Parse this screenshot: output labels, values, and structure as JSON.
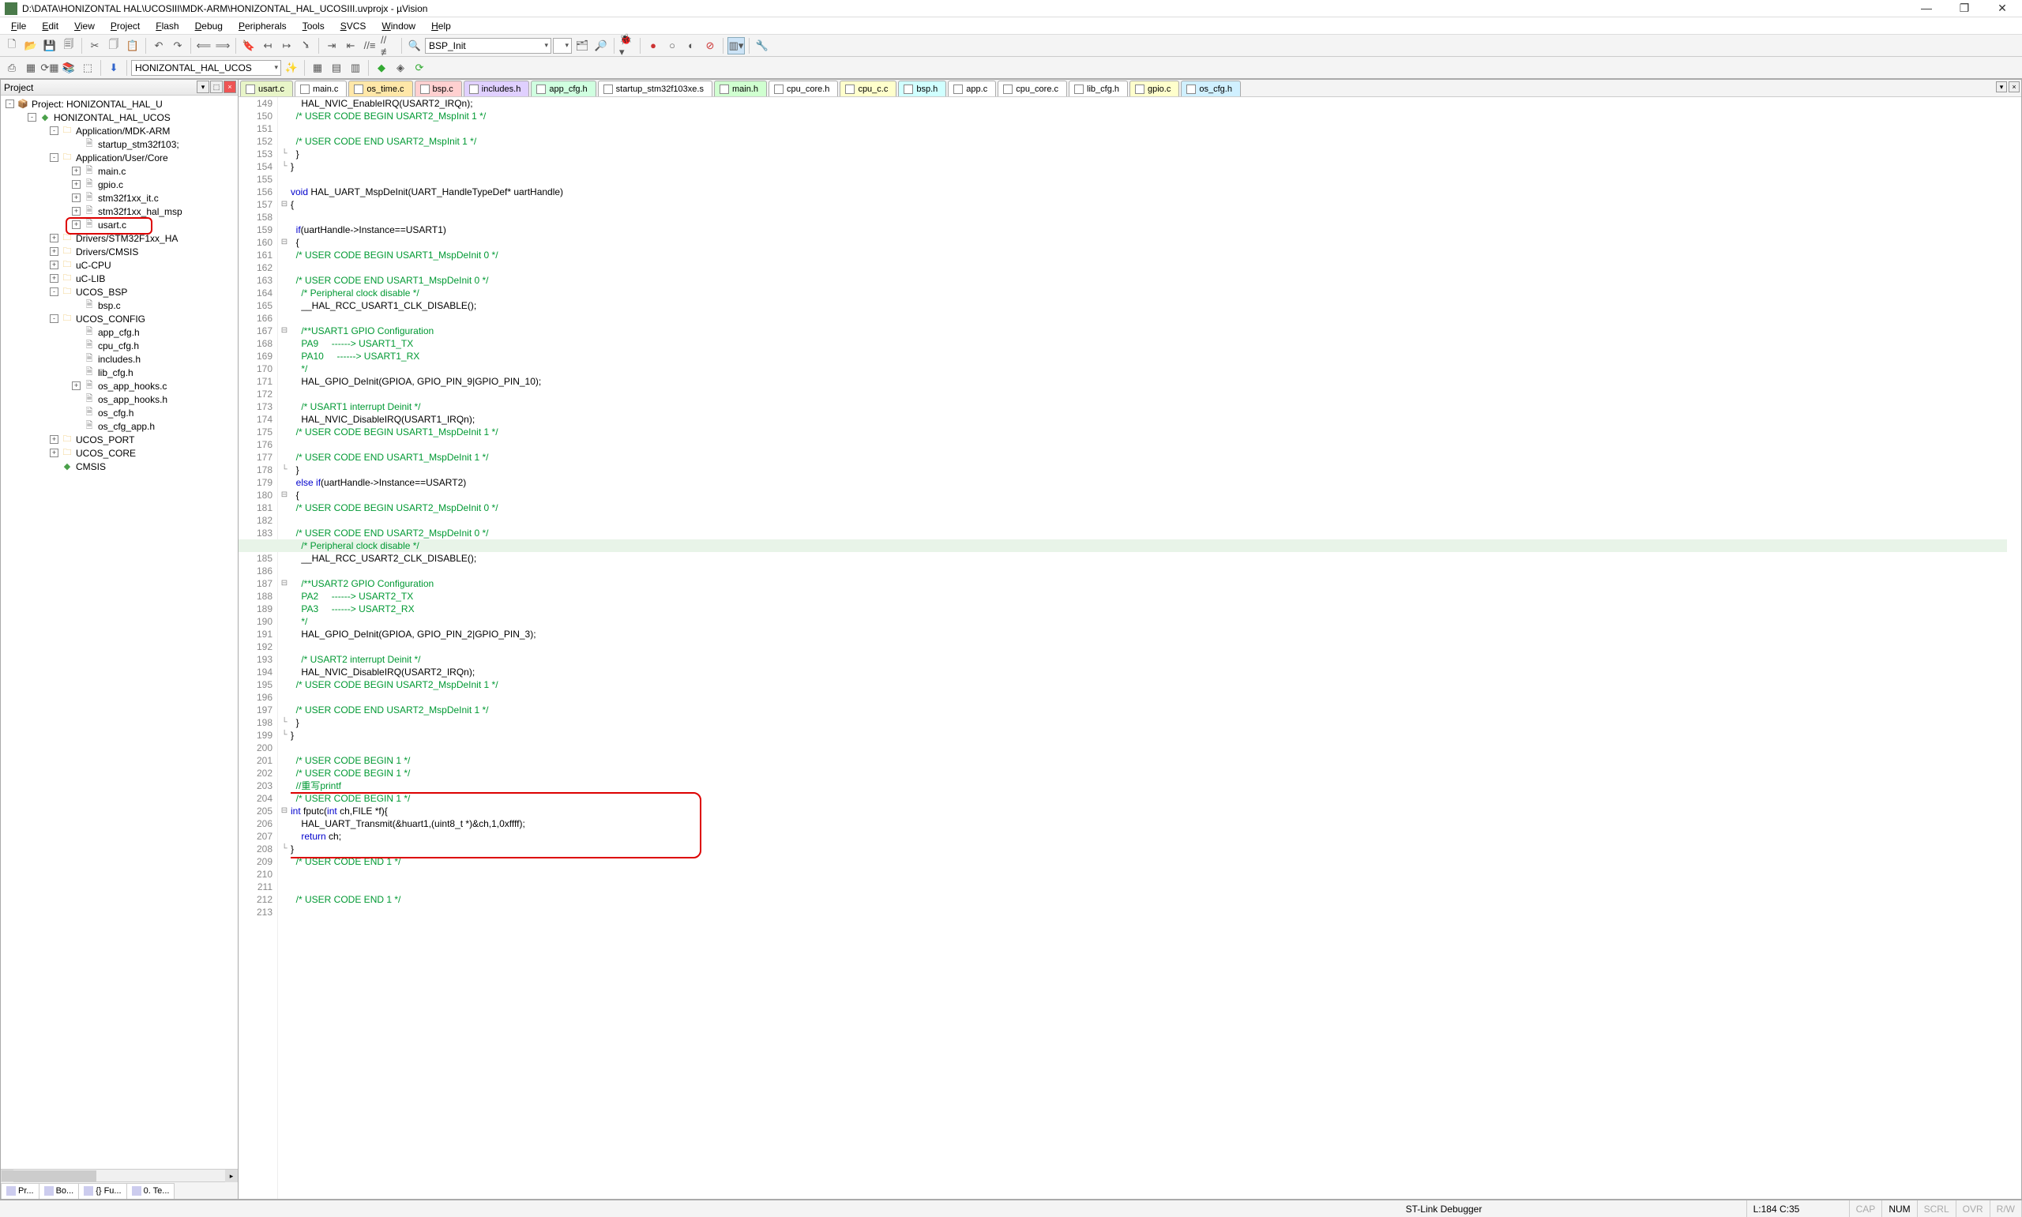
{
  "title_bar": {
    "title": "D:\\DATA\\HONIZONTAL HAL\\UCOSIII\\MDK-ARM\\HONIZONTAL_HAL_UCOSIII.uvprojx - µVision"
  },
  "menus": [
    "File",
    "Edit",
    "View",
    "Project",
    "Flash",
    "Debug",
    "Peripherals",
    "Tools",
    "SVCS",
    "Window",
    "Help"
  ],
  "toolbar2": {
    "target": "HONIZONTAL_HAL_UCOS"
  },
  "toolbar1": {
    "find": "BSP_Init"
  },
  "project_panel": {
    "title": "Project"
  },
  "tree": [
    {
      "d": 0,
      "exp": "-",
      "ico": "pkg",
      "label": "Project: HONIZONTAL_HAL_U"
    },
    {
      "d": 1,
      "exp": "-",
      "ico": "cube",
      "label": "HONIZONTAL_HAL_UCOS"
    },
    {
      "d": 2,
      "exp": "-",
      "ico": "folder",
      "label": "Application/MDK-ARM"
    },
    {
      "d": 3,
      "exp": " ",
      "ico": "file-c",
      "label": "startup_stm32f103;"
    },
    {
      "d": 2,
      "exp": "-",
      "ico": "folder",
      "label": "Application/User/Core"
    },
    {
      "d": 3,
      "exp": "+",
      "ico": "file-c",
      "label": "main.c"
    },
    {
      "d": 3,
      "exp": "+",
      "ico": "file-c",
      "label": "gpio.c"
    },
    {
      "d": 3,
      "exp": "+",
      "ico": "file-c",
      "label": "stm32f1xx_it.c"
    },
    {
      "d": 3,
      "exp": "+",
      "ico": "file-c",
      "label": "stm32f1xx_hal_msp"
    },
    {
      "d": 3,
      "exp": "+",
      "ico": "file-c",
      "label": "usart.c",
      "hl": true
    },
    {
      "d": 2,
      "exp": "+",
      "ico": "folder",
      "label": "Drivers/STM32F1xx_HA"
    },
    {
      "d": 2,
      "exp": "+",
      "ico": "folder",
      "label": "Drivers/CMSIS"
    },
    {
      "d": 2,
      "exp": "+",
      "ico": "folder",
      "label": "uC-CPU"
    },
    {
      "d": 2,
      "exp": "+",
      "ico": "folder",
      "label": "uC-LIB"
    },
    {
      "d": 2,
      "exp": "-",
      "ico": "folder",
      "label": "UCOS_BSP"
    },
    {
      "d": 3,
      "exp": " ",
      "ico": "file-c",
      "label": "bsp.c"
    },
    {
      "d": 2,
      "exp": "-",
      "ico": "folder",
      "label": "UCOS_CONFIG"
    },
    {
      "d": 3,
      "exp": " ",
      "ico": "file-h",
      "label": "app_cfg.h"
    },
    {
      "d": 3,
      "exp": " ",
      "ico": "file-h",
      "label": "cpu_cfg.h"
    },
    {
      "d": 3,
      "exp": " ",
      "ico": "file-h",
      "label": "includes.h"
    },
    {
      "d": 3,
      "exp": " ",
      "ico": "file-h",
      "label": "lib_cfg.h"
    },
    {
      "d": 3,
      "exp": "+",
      "ico": "file-c",
      "label": "os_app_hooks.c"
    },
    {
      "d": 3,
      "exp": " ",
      "ico": "file-h",
      "label": "os_app_hooks.h"
    },
    {
      "d": 3,
      "exp": " ",
      "ico": "file-h",
      "label": "os_cfg.h"
    },
    {
      "d": 3,
      "exp": " ",
      "ico": "file-h",
      "label": "os_cfg_app.h"
    },
    {
      "d": 2,
      "exp": "+",
      "ico": "folder",
      "label": "UCOS_PORT"
    },
    {
      "d": 2,
      "exp": "+",
      "ico": "folder",
      "label": "UCOS_CORE"
    },
    {
      "d": 2,
      "exp": " ",
      "ico": "cube",
      "label": "CMSIS"
    }
  ],
  "panel_tabs": [
    "Pr...",
    "Bo...",
    "{} Fu...",
    "0. Te..."
  ],
  "code_tabs": [
    {
      "label": "usart.c",
      "color": "#e8f5c8",
      "active": true
    },
    {
      "label": "main.c",
      "color": "#fff"
    },
    {
      "label": "os_time.c",
      "color": "#ffe7a8"
    },
    {
      "label": "bsp.c",
      "color": "#ffd0d0"
    },
    {
      "label": "includes.h",
      "color": "#e0d0ff"
    },
    {
      "label": "app_cfg.h",
      "color": "#d0ffe0"
    },
    {
      "label": "startup_stm32f103xe.s",
      "color": "#fff"
    },
    {
      "label": "main.h",
      "color": "#d0ffd0"
    },
    {
      "label": "cpu_core.h",
      "color": "#fff"
    },
    {
      "label": "cpu_c.c",
      "color": "#ffffcc"
    },
    {
      "label": "bsp.h",
      "color": "#d0ffff"
    },
    {
      "label": "app.c",
      "color": "#fff"
    },
    {
      "label": "cpu_core.c",
      "color": "#fff"
    },
    {
      "label": "lib_cfg.h",
      "color": "#fff"
    },
    {
      "label": "gpio.c",
      "color": "#ffffcc"
    },
    {
      "label": "os_cfg.h",
      "color": "#d0f0ff"
    }
  ],
  "editor": {
    "first_line": 149,
    "highlighted_line_index": 35,
    "lines": [
      {
        "t": "    HAL_NVIC_EnableIRQ(USART2_IRQn);"
      },
      {
        "t": "  /* USER CODE BEGIN USART2_MspInit 1 */",
        "cls": "cm"
      },
      {
        "t": ""
      },
      {
        "t": "  /* USER CODE END USART2_MspInit 1 */",
        "cls": "cm"
      },
      {
        "t": "  }",
        "fold": "└"
      },
      {
        "t": "}",
        "fold": "└"
      },
      {
        "t": ""
      },
      {
        "t": "void HAL_UART_MspDeInit(UART_HandleTypeDef* uartHandle)",
        "kw": "void"
      },
      {
        "t": "{",
        "fold": "⊟"
      },
      {
        "t": ""
      },
      {
        "t": "  if(uartHandle->Instance==USART1)",
        "kw": "if"
      },
      {
        "t": "  {",
        "fold": "⊟"
      },
      {
        "t": "  /* USER CODE BEGIN USART1_MspDeInit 0 */",
        "cls": "cm"
      },
      {
        "t": ""
      },
      {
        "t": "  /* USER CODE END USART1_MspDeInit 0 */",
        "cls": "cm"
      },
      {
        "t": "    /* Peripheral clock disable */",
        "cls": "cm"
      },
      {
        "t": "    __HAL_RCC_USART1_CLK_DISABLE();"
      },
      {
        "t": ""
      },
      {
        "t": "    /**USART1 GPIO Configuration",
        "cls": "cm",
        "fold": "⊟"
      },
      {
        "t": "    PA9     ------> USART1_TX",
        "cls": "cm"
      },
      {
        "t": "    PA10     ------> USART1_RX",
        "cls": "cm"
      },
      {
        "t": "    */",
        "cls": "cm"
      },
      {
        "t": "    HAL_GPIO_DeInit(GPIOA, GPIO_PIN_9|GPIO_PIN_10);"
      },
      {
        "t": ""
      },
      {
        "t": "    /* USART1 interrupt Deinit */",
        "cls": "cm"
      },
      {
        "t": "    HAL_NVIC_DisableIRQ(USART1_IRQn);"
      },
      {
        "t": "  /* USER CODE BEGIN USART1_MspDeInit 1 */",
        "cls": "cm"
      },
      {
        "t": ""
      },
      {
        "t": "  /* USER CODE END USART1_MspDeInit 1 */",
        "cls": "cm"
      },
      {
        "t": "  }",
        "fold": "└"
      },
      {
        "t": "  else if(uartHandle->Instance==USART2)",
        "kw": "else if"
      },
      {
        "t": "  {",
        "fold": "⊟"
      },
      {
        "t": "  /* USER CODE BEGIN USART2_MspDeInit 0 */",
        "cls": "cm"
      },
      {
        "t": ""
      },
      {
        "t": "  /* USER CODE END USART2_MspDeInit 0 */",
        "cls": "cm"
      },
      {
        "t": "    /* Peripheral clock disable */",
        "cls": "cm"
      },
      {
        "t": "    __HAL_RCC_USART2_CLK_DISABLE();"
      },
      {
        "t": ""
      },
      {
        "t": "    /**USART2 GPIO Configuration",
        "cls": "cm",
        "fold": "⊟"
      },
      {
        "t": "    PA2     ------> USART2_TX",
        "cls": "cm"
      },
      {
        "t": "    PA3     ------> USART2_RX",
        "cls": "cm"
      },
      {
        "t": "    */",
        "cls": "cm"
      },
      {
        "t": "    HAL_GPIO_DeInit(GPIOA, GPIO_PIN_2|GPIO_PIN_3);"
      },
      {
        "t": ""
      },
      {
        "t": "    /* USART2 interrupt Deinit */",
        "cls": "cm"
      },
      {
        "t": "    HAL_NVIC_DisableIRQ(USART2_IRQn);"
      },
      {
        "t": "  /* USER CODE BEGIN USART2_MspDeInit 1 */",
        "cls": "cm"
      },
      {
        "t": ""
      },
      {
        "t": "  /* USER CODE END USART2_MspDeInit 1 */",
        "cls": "cm"
      },
      {
        "t": "  }",
        "fold": "└"
      },
      {
        "t": "}",
        "fold": "└"
      },
      {
        "t": ""
      },
      {
        "t": "  /* USER CODE BEGIN 1 */",
        "cls": "cm"
      },
      {
        "t": "  /* USER CODE BEGIN 1 */",
        "cls": "cm"
      },
      {
        "t": "  //重写printf",
        "cls": "cm"
      },
      {
        "t": "  /* USER CODE BEGIN 1 */",
        "cls": "cm"
      },
      {
        "t": "int fputc(int ch,FILE *f){",
        "kw": "int",
        "fold": "⊟"
      },
      {
        "t": "    HAL_UART_Transmit(&huart1,(uint8_t *)&ch,1,0xffff);"
      },
      {
        "t": "    return ch;",
        "kw": "return"
      },
      {
        "t": "}",
        "fold": "└"
      },
      {
        "t": "  /* USER CODE END 1 */",
        "cls": "cm"
      },
      {
        "t": ""
      },
      {
        "t": ""
      },
      {
        "t": "  /* USER CODE END 1 */",
        "cls": "cm"
      },
      {
        "t": ""
      }
    ]
  },
  "status": {
    "debugger": "ST-Link Debugger",
    "pos": "L:184 C:35",
    "caps": "CAP",
    "num": "NUM",
    "scrl": "SCRL",
    "ovr": "OVR",
    "rw": "R/W"
  }
}
